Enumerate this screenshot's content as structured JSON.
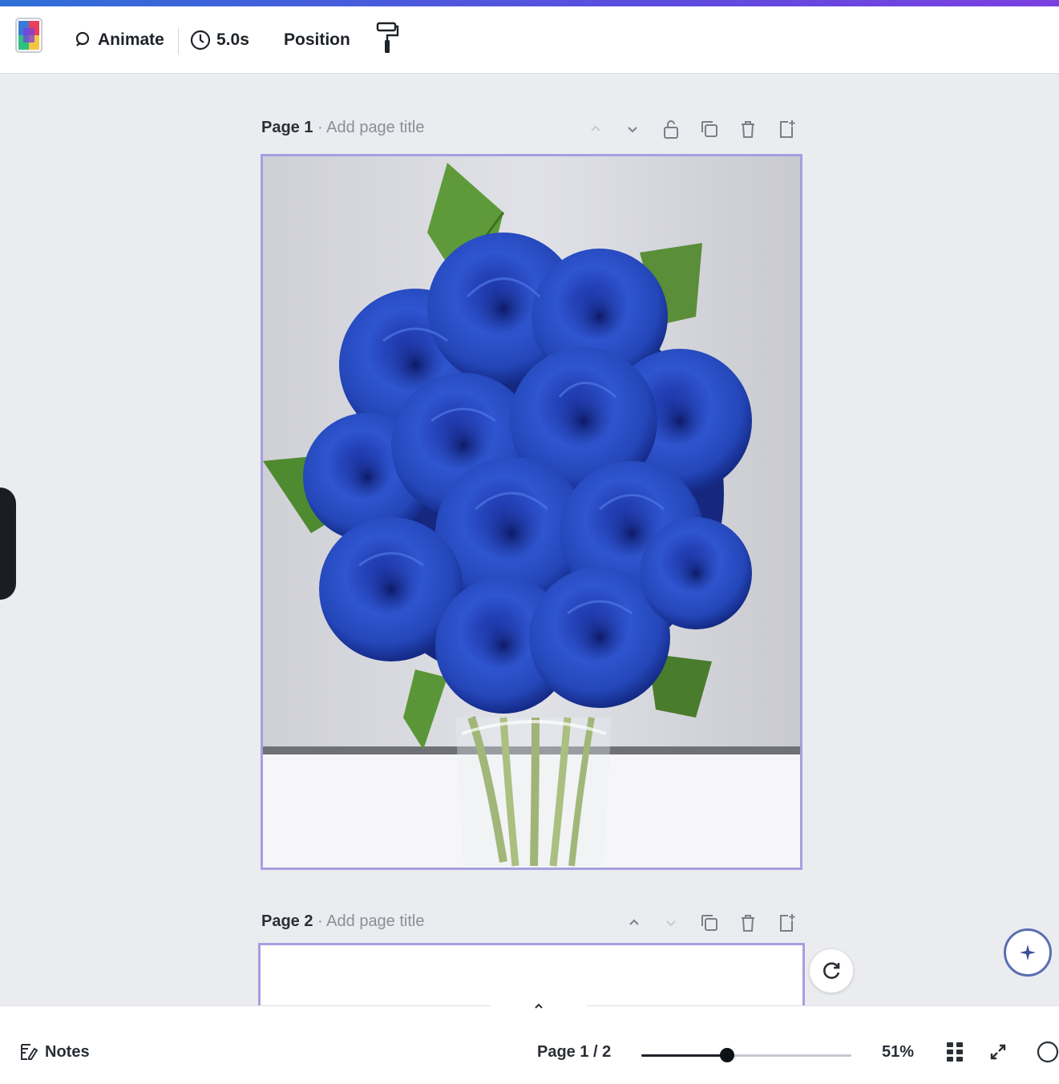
{
  "toolbar": {
    "animate_label": "Animate",
    "duration_label": "5.0s",
    "position_label": "Position"
  },
  "pages": [
    {
      "number_label": "Page 1",
      "title_placeholder": "Add page title",
      "photo_subject": "blue roses bouquet in glass vase"
    },
    {
      "number_label": "Page 2",
      "title_placeholder": "Add page title"
    }
  ],
  "footer": {
    "notes_label": "Notes",
    "page_indicator": "Page 1 / 2",
    "zoom_percent": 51,
    "zoom_label": "51%"
  },
  "colors": {
    "selection_border": "#a79ee0",
    "accent_stripe": "#5b4de0",
    "canvas_background": "#ebecf0"
  },
  "icons": {
    "app": "color-tile-icon",
    "animate": "animate-icon",
    "duration": "clock-icon",
    "style": "paint-roller-icon",
    "refresh": "refresh-icon",
    "assistant": "magic-sparkle-icon"
  }
}
